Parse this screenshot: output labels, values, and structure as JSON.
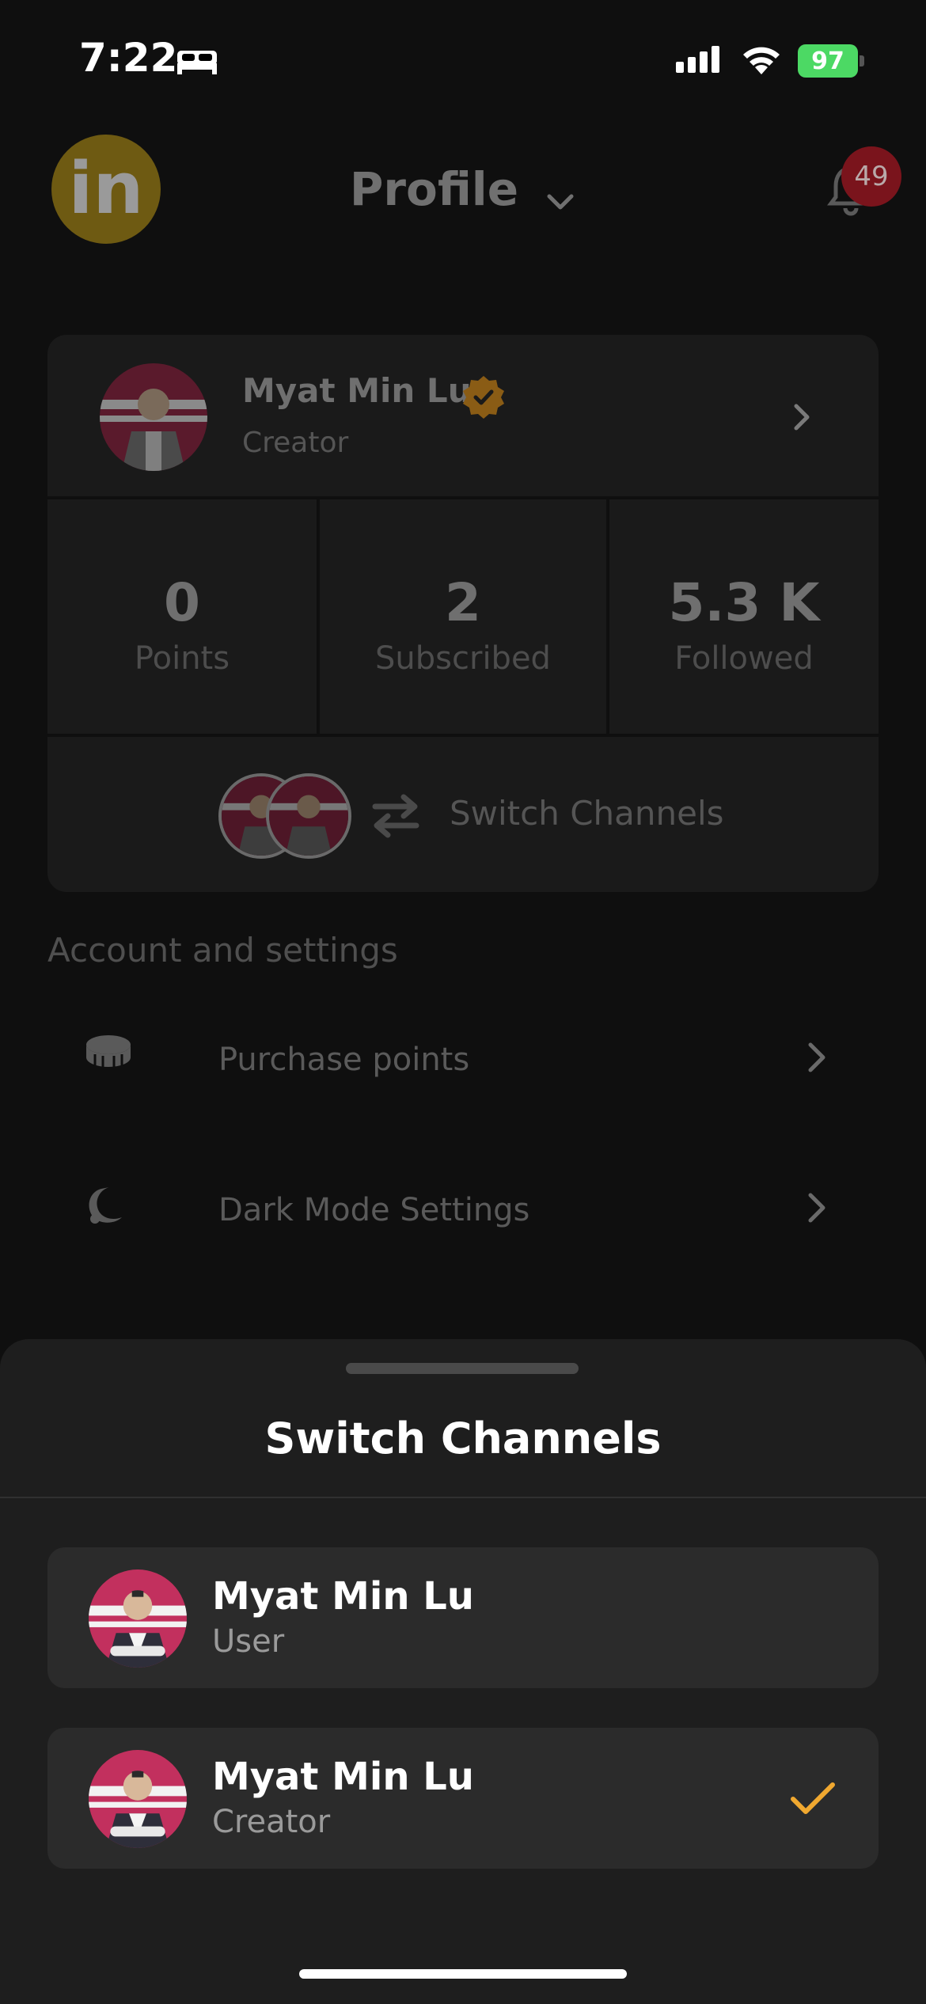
{
  "status_bar": {
    "time": "7:22",
    "battery": "97"
  },
  "header": {
    "title": "Profile",
    "notification_count": "49"
  },
  "profile": {
    "name": "Myat Min Lu",
    "role": "Creator"
  },
  "stats": [
    {
      "value": "0",
      "label": "Points"
    },
    {
      "value": "2",
      "label": "Subscribed"
    },
    {
      "value": "5.3 K",
      "label": "Followed"
    }
  ],
  "switch_channels_label": "Switch Channels",
  "settings": {
    "section_title": "Account and settings",
    "items": [
      {
        "label": "Purchase points",
        "icon": "coin-icon"
      },
      {
        "label": "Dark Mode Settings",
        "icon": "moon-icon"
      }
    ]
  },
  "sheet": {
    "title": "Switch Channels",
    "channels": [
      {
        "name": "Myat Min Lu",
        "role": "User",
        "selected": false
      },
      {
        "name": "Myat Min Lu",
        "role": "Creator",
        "selected": true
      }
    ]
  },
  "colors": {
    "accent": "#f0a830",
    "badge": "#d0202e",
    "battery": "#4cd964"
  }
}
